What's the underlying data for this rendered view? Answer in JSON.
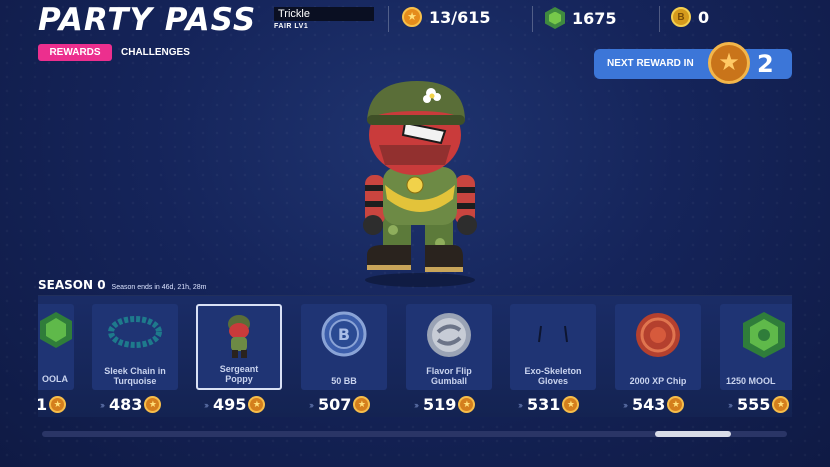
{
  "header": {
    "title": "PARTY PASS",
    "player_name": "Trickle",
    "player_level": "FAIR LV1",
    "stars": "13/615",
    "gems": "1675",
    "coins": "0",
    "coin_symbol": "B"
  },
  "tabs": [
    {
      "label": "REWARDS",
      "active": true
    },
    {
      "label": "CHALLENGES",
      "active": false
    }
  ],
  "next_reward": {
    "label": "NEXT REWARD IN",
    "value": "2"
  },
  "season": {
    "name": "SEASON 0",
    "ends": "Season ends in 46d, 21h, 28m"
  },
  "rewards": [
    {
      "name": "OOLA",
      "tier": "1",
      "icon": "gem-icon",
      "partial": true
    },
    {
      "name": "Sleek Chain in\nTurquoise",
      "tier": "483",
      "icon": "chain-icon"
    },
    {
      "name": "Sergeant\nPoppy",
      "tier": "495",
      "icon": "character-icon",
      "selected": true
    },
    {
      "name": "50 BB",
      "tier": "507",
      "icon": "bb-coin-icon"
    },
    {
      "name": "Flavor Flip\nGumball",
      "tier": "519",
      "icon": "gumball-icon"
    },
    {
      "name": "Exo-Skeleton\nGloves",
      "tier": "531",
      "icon": "gloves-icon"
    },
    {
      "name": "2000 XP Chip",
      "tier": "543",
      "icon": "xp-chip-icon"
    },
    {
      "name": "1250 MOOL",
      "tier": "555",
      "icon": "mool-gem-icon",
      "partial": true
    }
  ],
  "colors": {
    "accent": "#ec2f8e",
    "next_reward_bg": "#3c76d8",
    "star": "#d47f1d"
  }
}
